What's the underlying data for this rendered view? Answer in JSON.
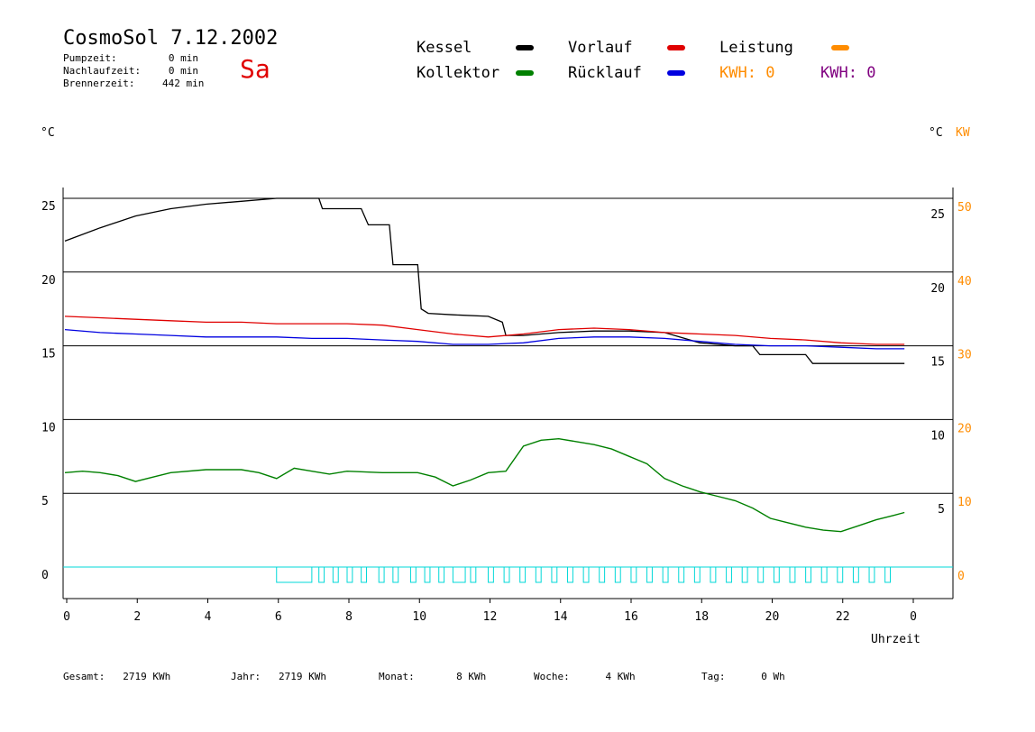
{
  "header": {
    "title": "CosmoSol 7.12.2002",
    "day": "Sa",
    "stats": [
      {
        "label": "Pumpzeit:",
        "value": "0 min"
      },
      {
        "label": "Nachlaufzeit:",
        "value": "0 min"
      },
      {
        "label": "Brennerzeit:",
        "value": "442 min"
      }
    ]
  },
  "legend": {
    "kessel": "Kessel",
    "kollektor": "Kollektor",
    "vorlauf": "Vorlauf",
    "ruecklauf": "Rücklauf",
    "leistung": "Leistung",
    "kwh1_label": "KWH:",
    "kwh1_value": "0",
    "kwh2_label": "KWH:",
    "kwh2_value": "0"
  },
  "axes": {
    "left_unit": "°C",
    "right_unit_c": "°C",
    "right_unit_kw": "KW",
    "xlabel": "Uhrzeit"
  },
  "footer": {
    "gesamt_label": "Gesamt:",
    "gesamt_value": "2719 KWh",
    "jahr_label": "Jahr:",
    "jahr_value": "2719 KWh",
    "monat_label": "Monat:",
    "monat_value": "8 KWh",
    "woche_label": "Woche:",
    "woche_value": "4 KWh",
    "tag_label": "Tag:",
    "tag_value": "0 Wh"
  },
  "colors": {
    "kessel": "#000000",
    "kollektor": "#008000",
    "vorlauf": "#e00000",
    "ruecklauf": "#0000e0",
    "leistung": "#ff8c00",
    "kwh2": "#800080",
    "pump": "#00d8d8",
    "burner": "#c00060"
  },
  "chart_data": {
    "type": "line",
    "xlim": [
      0,
      24
    ],
    "ylim": [
      -1,
      26
    ],
    "y_ticks": [
      "0",
      "5",
      "10",
      "15",
      "20",
      "25"
    ],
    "y_tick_values": [
      0,
      5,
      10,
      15,
      20,
      25
    ],
    "x_ticks": [
      "0",
      "2",
      "4",
      "6",
      "8",
      "10",
      "12",
      "14",
      "16",
      "18",
      "20",
      "22",
      "0"
    ],
    "x_tick_values": [
      0,
      2,
      4,
      6,
      8,
      10,
      12,
      14,
      16,
      18,
      20,
      22,
      24
    ],
    "right_c_ticks": [
      "25",
      "20",
      "15",
      "10",
      "5"
    ],
    "right_kw_ticks": [
      "50",
      "40",
      "30",
      "20",
      "10",
      "0"
    ],
    "series": [
      {
        "key": "kessel",
        "x": [
          0,
          1,
          2,
          3,
          4,
          5,
          6,
          7,
          7.2,
          7.3,
          8.2,
          8.4,
          8.6,
          9.0,
          9.2,
          9.3,
          10.0,
          10.1,
          10.3,
          11,
          12,
          12.4,
          12.5,
          13,
          14,
          15,
          16,
          17,
          18,
          19,
          19.5,
          19.7,
          20.5,
          21,
          21.2,
          22,
          23,
          23.8
        ],
        "y": [
          22.1,
          23.0,
          23.8,
          24.3,
          24.6,
          24.8,
          25.0,
          25.0,
          25.0,
          24.3,
          24.3,
          24.3,
          23.2,
          23.2,
          23.2,
          20.5,
          20.5,
          17.5,
          17.2,
          17.1,
          17.0,
          16.6,
          15.7,
          15.7,
          15.9,
          16.0,
          16.0,
          15.9,
          15.2,
          15.0,
          15.0,
          14.4,
          14.4,
          14.4,
          13.8,
          13.8,
          13.8,
          13.8
        ]
      },
      {
        "key": "vorlauf",
        "x": [
          0,
          1,
          2,
          3,
          4,
          5,
          6,
          7,
          8,
          9,
          10,
          11,
          12,
          13,
          14,
          15,
          16,
          17,
          18,
          19,
          20,
          21,
          22,
          23,
          23.8
        ],
        "y": [
          17.0,
          16.9,
          16.8,
          16.7,
          16.6,
          16.6,
          16.5,
          16.5,
          16.5,
          16.4,
          16.1,
          15.8,
          15.6,
          15.8,
          16.1,
          16.2,
          16.1,
          15.9,
          15.8,
          15.7,
          15.5,
          15.4,
          15.2,
          15.1,
          15.1
        ]
      },
      {
        "key": "ruecklauf",
        "x": [
          0,
          1,
          2,
          3,
          4,
          5,
          6,
          7,
          8,
          9,
          10,
          11,
          12,
          13,
          14,
          15,
          16,
          17,
          18,
          19,
          20,
          21,
          22,
          23,
          23.8
        ],
        "y": [
          16.1,
          15.9,
          15.8,
          15.7,
          15.6,
          15.6,
          15.6,
          15.5,
          15.5,
          15.4,
          15.3,
          15.1,
          15.1,
          15.2,
          15.5,
          15.6,
          15.6,
          15.5,
          15.3,
          15.1,
          15.0,
          15.0,
          14.9,
          14.8,
          14.8
        ]
      },
      {
        "key": "kollektor",
        "x": [
          0,
          0.5,
          1,
          1.5,
          2,
          2.5,
          3,
          4,
          5,
          5.5,
          6,
          6.5,
          7,
          7.5,
          8,
          9,
          10,
          10.5,
          11,
          11.5,
          12,
          12.5,
          13,
          13.5,
          14,
          14.5,
          15,
          15.5,
          16,
          16.5,
          17,
          17.5,
          18,
          18.5,
          19,
          19.5,
          20,
          20.5,
          21,
          21.5,
          22,
          22.5,
          23,
          23.5,
          23.8
        ],
        "y": [
          6.4,
          6.5,
          6.4,
          6.2,
          5.8,
          6.1,
          6.4,
          6.6,
          6.6,
          6.4,
          6.0,
          6.7,
          6.5,
          6.3,
          6.5,
          6.4,
          6.4,
          6.1,
          5.5,
          5.9,
          6.4,
          6.5,
          8.2,
          8.6,
          8.7,
          8.5,
          8.3,
          8.0,
          7.5,
          7.0,
          6.0,
          5.5,
          5.1,
          4.8,
          4.5,
          4.0,
          3.3,
          3.0,
          2.7,
          2.5,
          2.4,
          2.8,
          3.2,
          3.5,
          3.7
        ]
      }
    ]
  }
}
